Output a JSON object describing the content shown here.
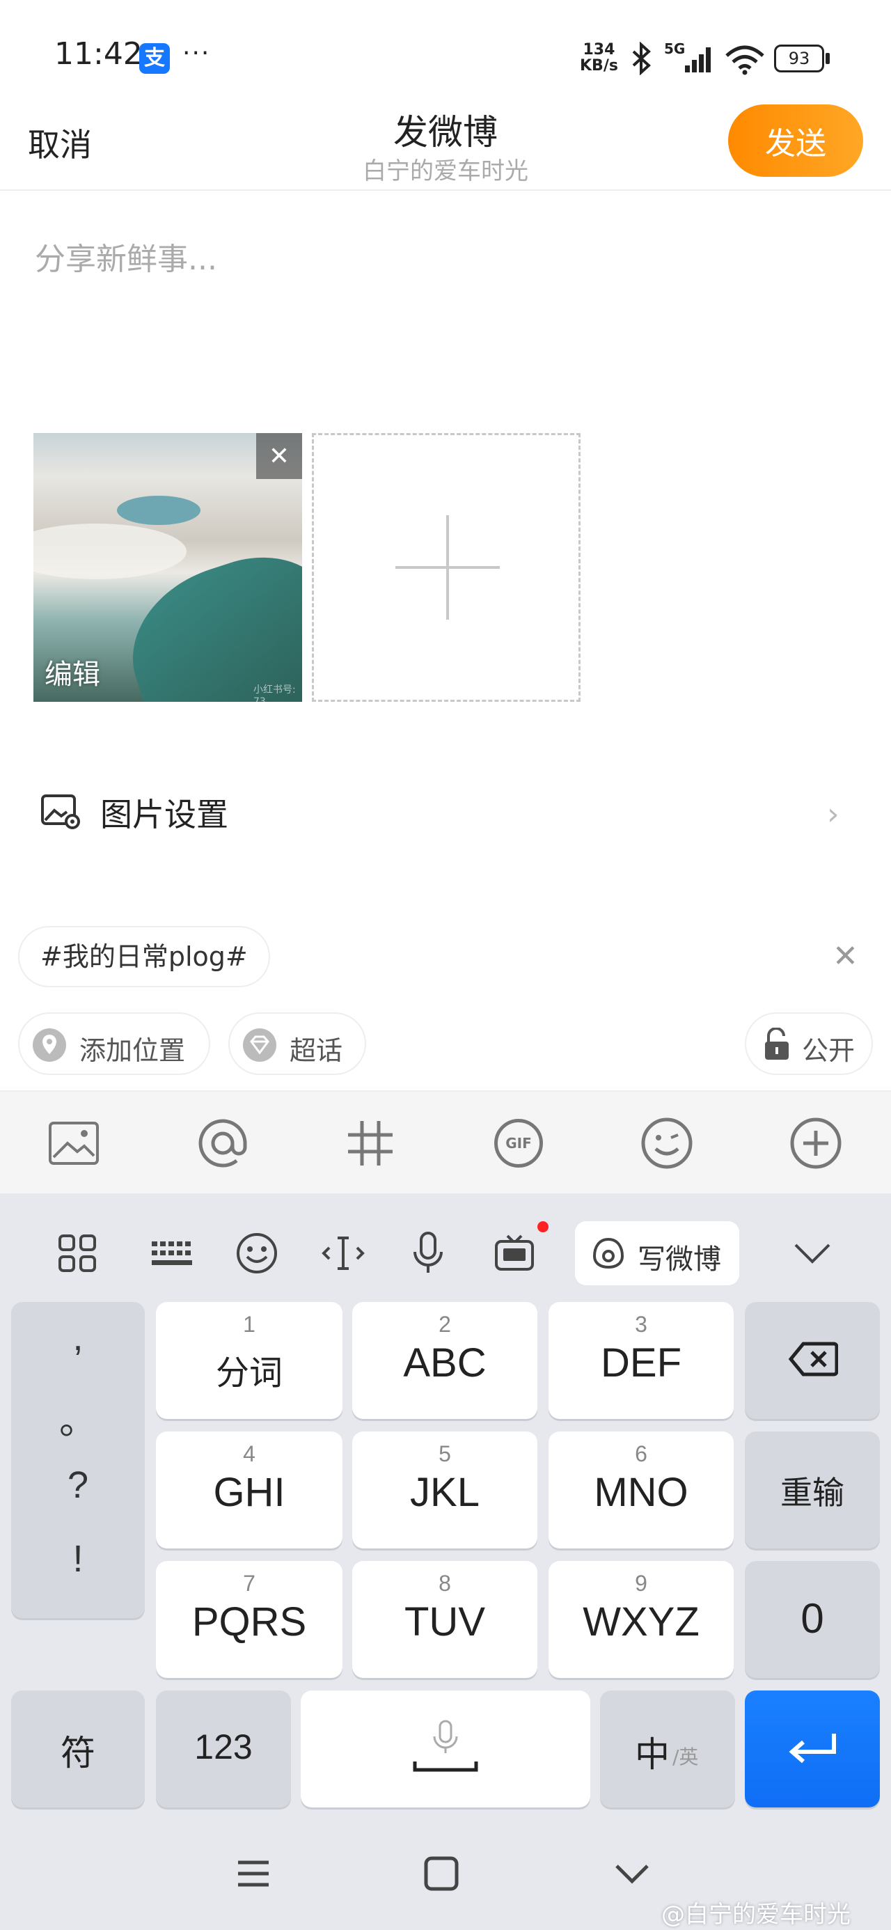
{
  "status_bar": {
    "time": "11:42",
    "alipay_glyph": "支",
    "more": "···",
    "net_speed_value": "134",
    "net_speed_unit": "KB/s",
    "signal_label": "5G",
    "battery": "93"
  },
  "header": {
    "cancel_label": "取消",
    "title": "发微博",
    "subtitle": "白宁的爱车时光",
    "send_label": "发送"
  },
  "compose": {
    "placeholder": "分享新鲜事..."
  },
  "images": {
    "edit_label": "编辑",
    "close_glyph": "✕",
    "watermark": "小红书号: 73"
  },
  "image_settings": {
    "label": "图片设置",
    "chevron": "›"
  },
  "topic": {
    "label": "#我的日常plog#",
    "close_glyph": "✕"
  },
  "chips": {
    "location": "添加位置",
    "super_topic": "超话",
    "visibility": "公开"
  },
  "toolbar": {
    "gif": "GIF"
  },
  "keyboard": {
    "write_weibo": "写微博",
    "punctuation": [
      ",",
      "。",
      "?",
      "!"
    ],
    "keys": [
      {
        "num": "1",
        "label": "分词"
      },
      {
        "num": "2",
        "label": "ABC"
      },
      {
        "num": "3",
        "label": "DEF"
      },
      {
        "num": "4",
        "label": "GHI"
      },
      {
        "num": "5",
        "label": "JKL"
      },
      {
        "num": "6",
        "label": "MNO"
      },
      {
        "num": "7",
        "label": "PQRS"
      },
      {
        "num": "8",
        "label": "TUV"
      },
      {
        "num": "9",
        "label": "WXYZ"
      }
    ],
    "retype": "重输",
    "zero": "0",
    "symbols": "符",
    "numbers": "123",
    "lang_main": "中",
    "lang_sub": "/英"
  },
  "watermark": "@白宁的爱车时光",
  "colors": {
    "accent_orange": "#ff8a00",
    "enter_blue": "#1a80ff",
    "keyboard_bg": "#e6e8ee"
  }
}
